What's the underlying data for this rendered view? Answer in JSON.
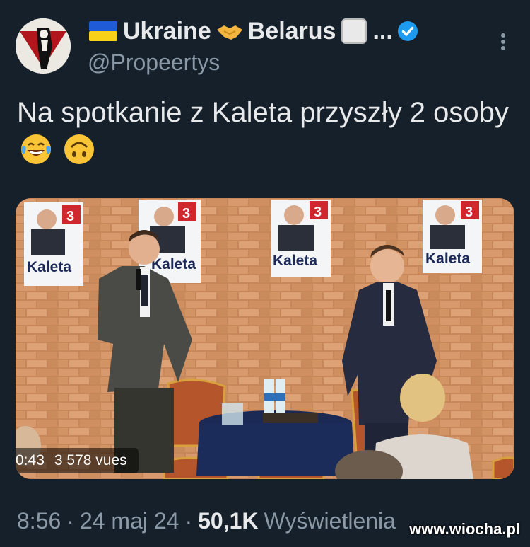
{
  "author": {
    "display_name": "Ukraine",
    "display_name_part2": "Belarus",
    "ellipsis": "...",
    "handle": "@Propeertys",
    "verified": true,
    "flag_ukraine_colors": [
      "#1f5bd6",
      "#f7d117"
    ],
    "verified_color": "#1d9bf0"
  },
  "tweet": {
    "text": "Na spotkanie z Kaleta przyszły 2 osoby",
    "emojis": [
      "laughing-with-tears",
      "upside-down-face"
    ]
  },
  "media": {
    "posters": [
      {
        "label": "Kaleta",
        "number": "3"
      },
      {
        "label": "Kaleta",
        "number": "3"
      },
      {
        "label": "Kaleta",
        "number": "3"
      },
      {
        "label": "Kaleta",
        "number": "3"
      }
    ],
    "video_time": "0:43",
    "view_count": "3 578",
    "view_label": "vues"
  },
  "meta": {
    "time": "8:56",
    "sep1": "·",
    "date": "24 maj 24",
    "sep2": "·",
    "views": "50,1K",
    "views_label": "Wyświetlenia"
  },
  "watermark": "www.wiocha.pl"
}
